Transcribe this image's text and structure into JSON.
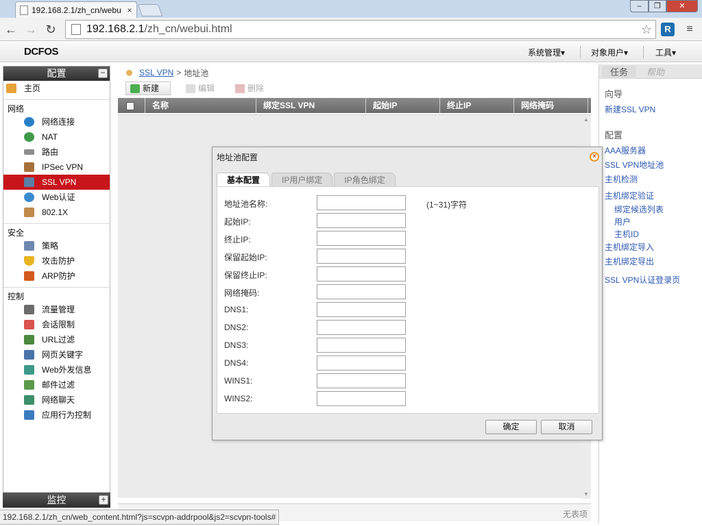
{
  "browser": {
    "tab_title": "192.168.2.1/zh_cn/webu",
    "tab_close": "×",
    "url_host": "192.168.2.1",
    "url_path": "/zh_cn/webui.html",
    "status_url": "192.168.2.1/zh_cn/web_content.html?js=scvpn-addrpool&js2=scvpn-tools#"
  },
  "header": {
    "logo": "DCFOS",
    "menus": [
      "系统管理▾",
      "对象用户▾",
      "工具▾"
    ]
  },
  "sidebar": {
    "title": "配置",
    "footer_title": "监控",
    "home": "主页",
    "groups": [
      {
        "label": "网络",
        "items": [
          "网络连接",
          "NAT",
          "路由",
          "IPSec VPN",
          "SSL VPN",
          "Web认证",
          "802.1X"
        ]
      },
      {
        "label": "安全",
        "items": [
          "策略",
          "攻击防护",
          "ARP防护"
        ]
      },
      {
        "label": "控制",
        "items": [
          "流量管理",
          "会话限制",
          "URL过滤",
          "网页关键字",
          "Web外发信息",
          "邮件过滤",
          "网络聊天",
          "应用行为控制"
        ]
      }
    ],
    "active_item": "SSL VPN"
  },
  "breadcrumb": {
    "link": "SSL VPN",
    "sep": ">",
    "current": "地址池"
  },
  "actions": {
    "new": "新建",
    "edit": "编辑",
    "delete": "删除"
  },
  "table": {
    "columns": [
      "名称",
      "绑定SSL VPN",
      "起始IP",
      "终止IP",
      "网络掩码"
    ],
    "empty_text": "无表项"
  },
  "right_panel": {
    "tabs": [
      "任务",
      "帮助"
    ],
    "sections": [
      {
        "title": "向导",
        "links": [
          "新建SSL VPN"
        ]
      },
      {
        "title": "配置",
        "links": [
          "AAA服务器",
          "SSL VPN地址池",
          "主机检测",
          "主机绑定验证"
        ]
      }
    ],
    "sub_links": [
      "绑定候选列表",
      "用户",
      "主机ID"
    ],
    "more_links": [
      "主机绑定导入",
      "主机绑定导出"
    ],
    "last_link": "SSL VPN认证登录页"
  },
  "dialog": {
    "title": "地址池配置",
    "close": "×",
    "tabs": [
      "基本配置",
      "IP用户绑定",
      "IP角色绑定"
    ],
    "fields": [
      {
        "label": "地址池名称:",
        "value": "",
        "hint": "(1~31)字符"
      },
      {
        "label": "起始IP:",
        "value": ""
      },
      {
        "label": "终止IP:",
        "value": ""
      },
      {
        "label": "保留起始IP:",
        "value": ""
      },
      {
        "label": "保留终止IP:",
        "value": ""
      },
      {
        "label": "网络掩码:",
        "value": ""
      },
      {
        "label": "DNS1:",
        "value": ""
      },
      {
        "label": "DNS2:",
        "value": ""
      },
      {
        "label": "DNS3:",
        "value": ""
      },
      {
        "label": "DNS4:",
        "value": ""
      },
      {
        "label": "WINS1:",
        "value": ""
      },
      {
        "label": "WINS2:",
        "value": ""
      }
    ],
    "ok": "确定",
    "cancel": "取消"
  },
  "colors": {
    "active_nav": "#c8151b",
    "link": "#2c58b0",
    "dialog_close_ring": "#e89a2a"
  }
}
